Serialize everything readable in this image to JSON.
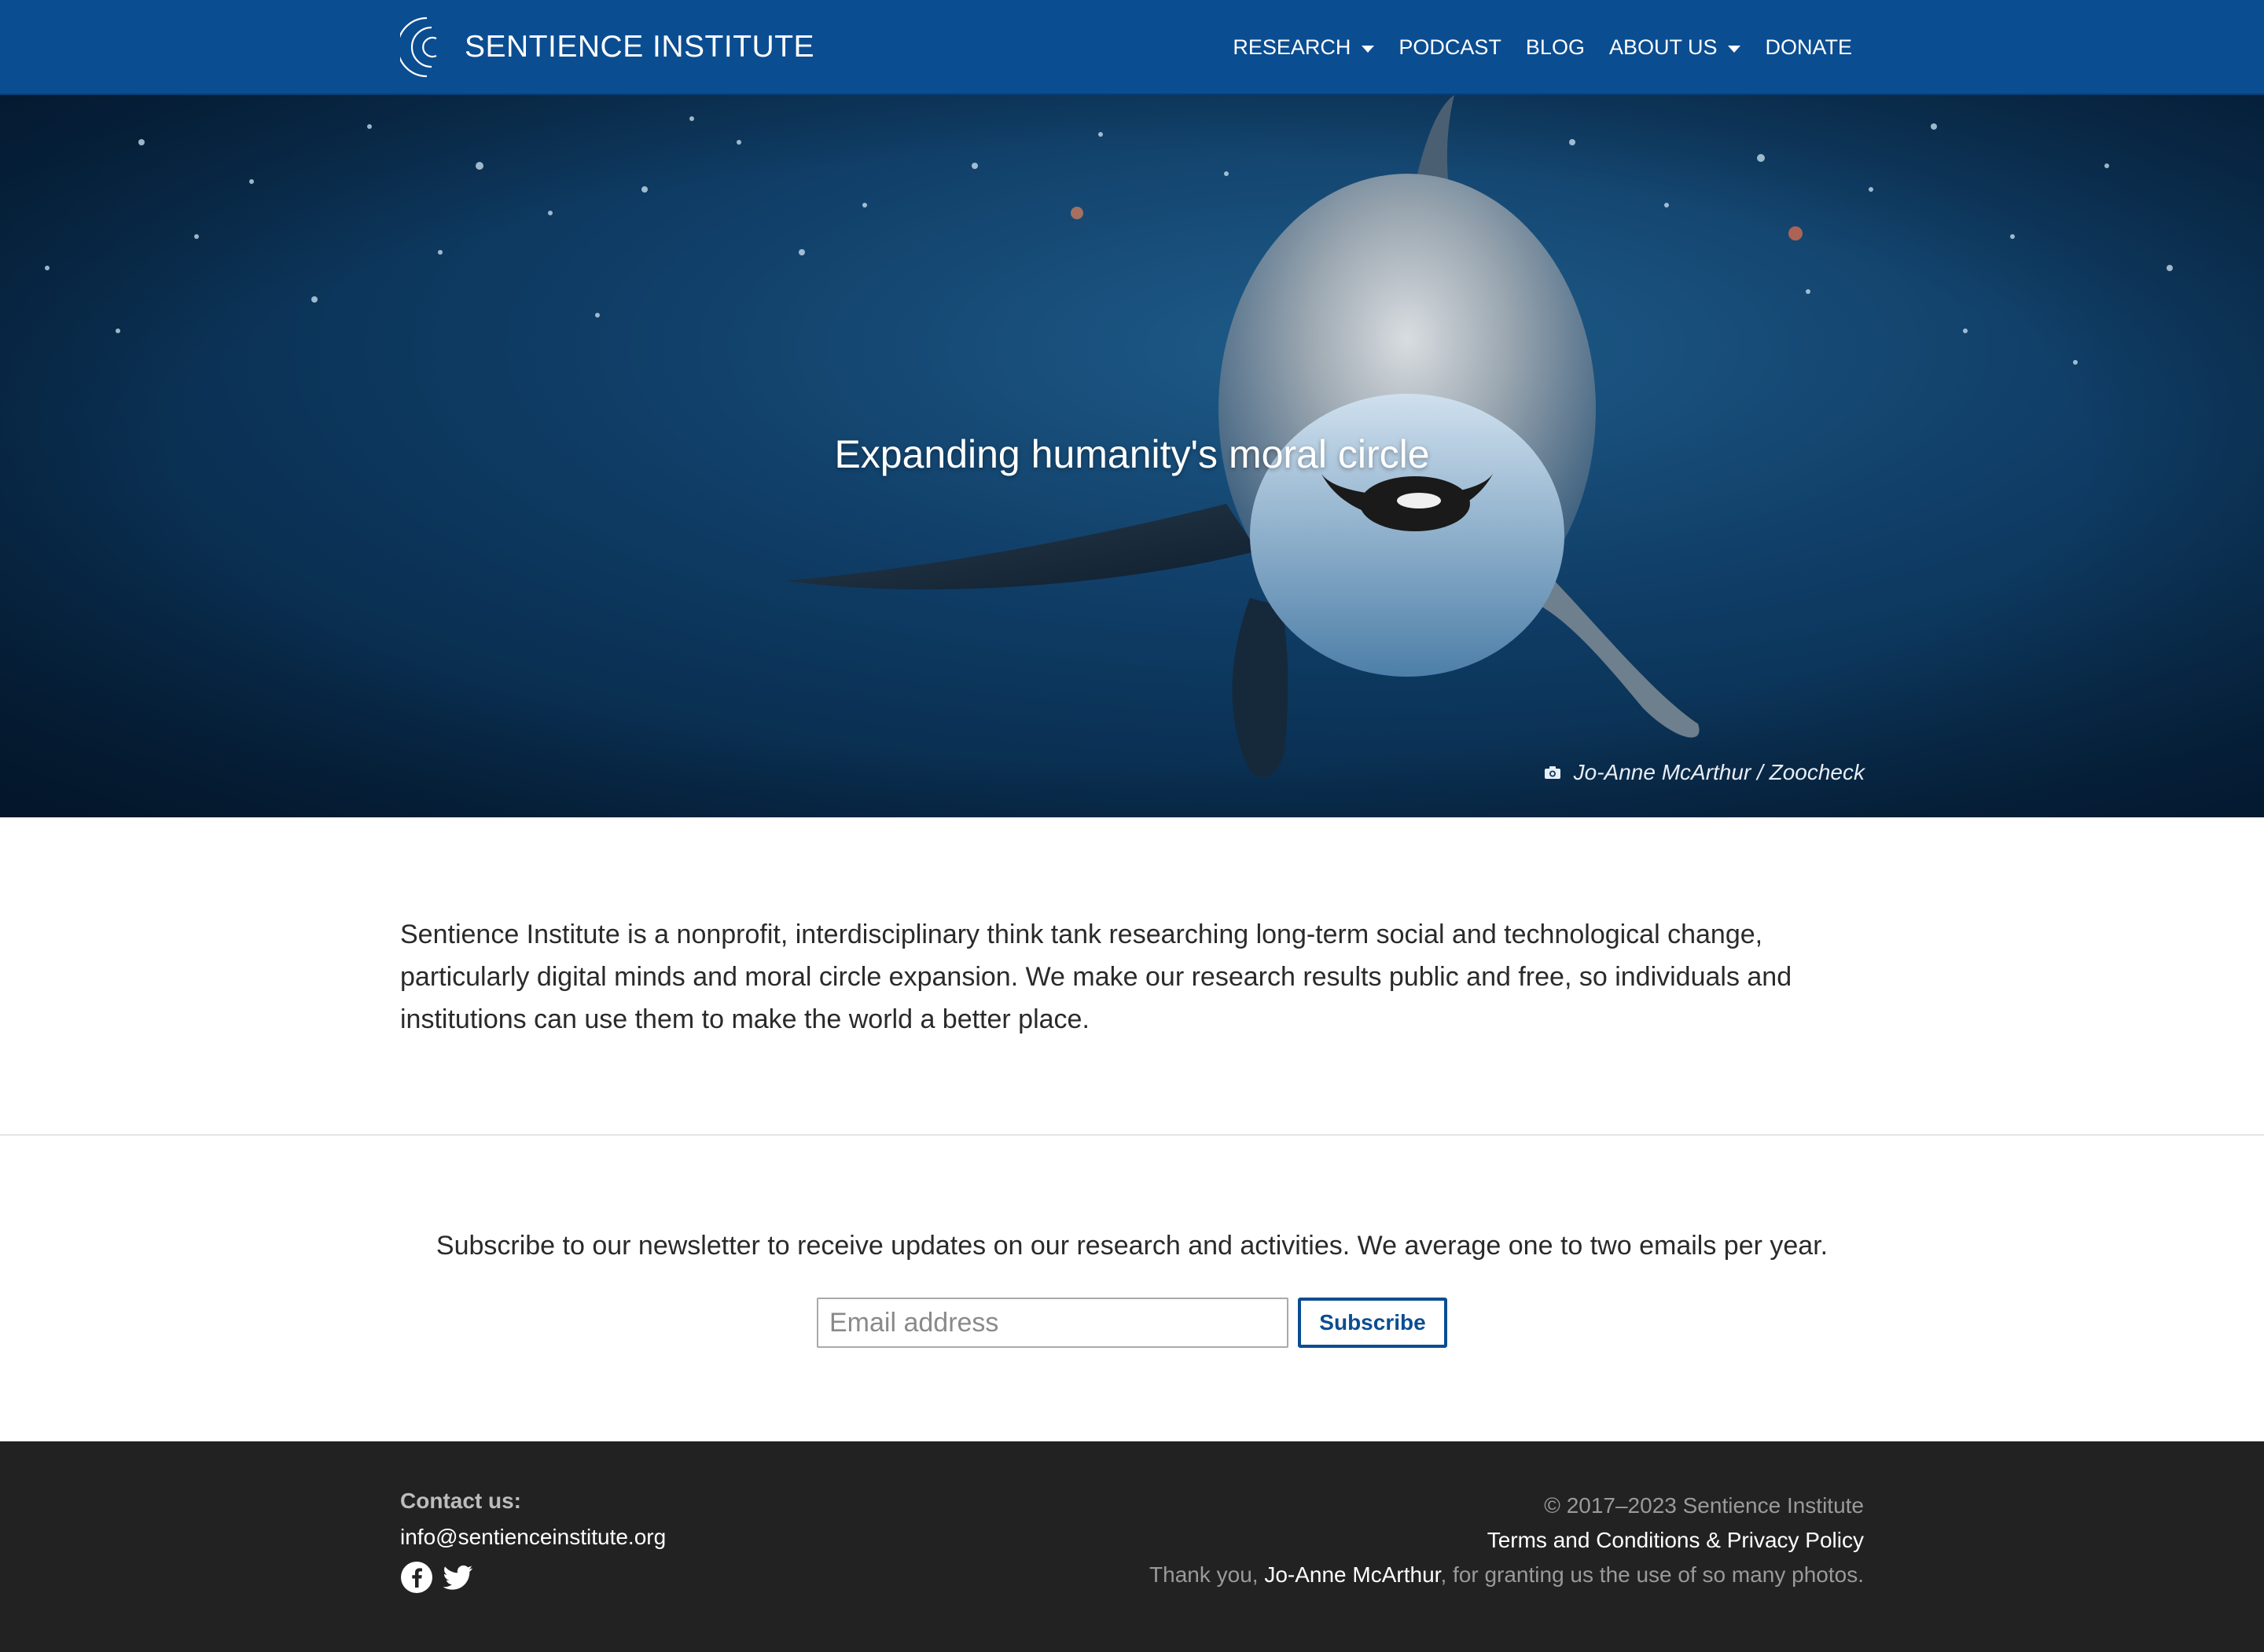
{
  "brand": {
    "name": "SENTIENCE INSTITUTE"
  },
  "nav": {
    "items": [
      {
        "label": "RESEARCH",
        "dropdown": true
      },
      {
        "label": "PODCAST",
        "dropdown": false
      },
      {
        "label": "BLOG",
        "dropdown": false
      },
      {
        "label": "ABOUT US",
        "dropdown": true
      },
      {
        "label": "DONATE",
        "dropdown": false
      }
    ]
  },
  "hero": {
    "title": "Expanding humanity's moral circle",
    "photo_credit": "Jo-Anne McArthur / Zoocheck",
    "credit_icon": "camera-icon"
  },
  "intro": {
    "text": "Sentience Institute is a nonprofit, interdisciplinary think tank researching long-term social and technological change, particularly digital minds and moral circle expansion. We make our research results public and free, so individuals and institutions can use them to make the world a better place."
  },
  "newsletter": {
    "text": "Subscribe to our newsletter to receive updates on our research and activities. We average one to two emails per year.",
    "email_placeholder": "Email address",
    "email_value": "",
    "button_label": "Subscribe"
  },
  "footer": {
    "contact_label": "Contact us:",
    "contact_email": "info@sentienceinstitute.org",
    "social_icons": [
      "facebook-icon",
      "twitter-icon"
    ],
    "copyright": "© 2017–2023 Sentience Institute",
    "terms": "Terms and Conditions & Privacy Policy",
    "thanks_prefix": "Thank you, ",
    "thanks_name": "Jo-Anne McArthur",
    "thanks_suffix": ", for granting us the use of so many photos."
  },
  "colors": {
    "nav_bg": "#0b4d91",
    "footer_bg": "#222222",
    "accent": "#0b4d91"
  }
}
